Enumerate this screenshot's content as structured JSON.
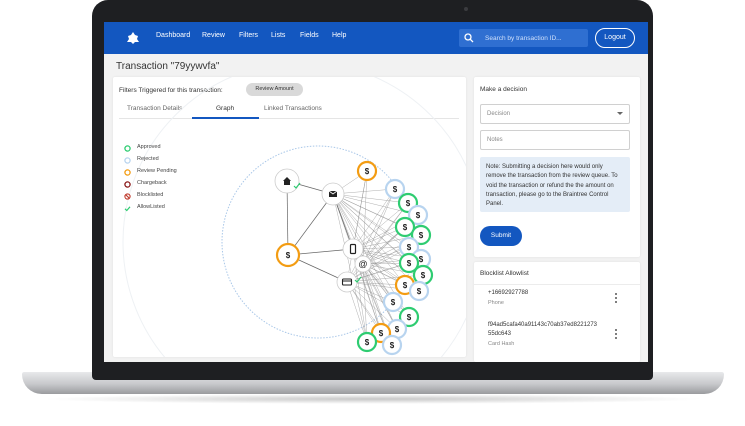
{
  "brand_color": "#1357c0",
  "nav": {
    "logo_icon": "braintree-logo-icon",
    "items": [
      {
        "label": "Dashboard"
      },
      {
        "label": "Review"
      },
      {
        "label": "Filters"
      },
      {
        "label": "Lists"
      },
      {
        "label": "Fields"
      },
      {
        "label": "Help"
      }
    ],
    "search_placeholder": "Search by transaction ID...",
    "logout_label": "Logout"
  },
  "page": {
    "title": "Transaction \"79yywvfa\""
  },
  "transaction": {
    "filters_label": "Filters Triggered for this transaction:",
    "filter_chip": "Review Amount",
    "tabs": [
      {
        "label": "Transaction Details",
        "active": false
      },
      {
        "label": "Graph",
        "active": true
      },
      {
        "label": "Linked Transactions",
        "active": false
      }
    ],
    "legend": [
      {
        "label": "Approved",
        "icon": "approved-ring-icon",
        "color": "#2ecc71"
      },
      {
        "label": "Rejected",
        "icon": "rejected-ring-icon",
        "color": "#b8d4ef"
      },
      {
        "label": "Review Pending",
        "icon": "review-pending-ring-icon",
        "color": "#f39c12"
      },
      {
        "label": "Chargeback",
        "icon": "chargeback-ring-icon",
        "color": "#8b1a1a"
      },
      {
        "label": "Blocklisted",
        "icon": "blocklisted-icon",
        "color": "#c0392b"
      },
      {
        "label": "AllowListed",
        "icon": "checkmark-icon",
        "color": "#2ecc71"
      }
    ],
    "graph": {
      "node_icons": [
        "home-icon",
        "mail-icon",
        "phone-icon",
        "at-sign-icon",
        "card-icon",
        "dollar-icon"
      ]
    }
  },
  "decision": {
    "title": "Make a decision",
    "decision_placeholder": "Decision",
    "notes_placeholder": "Notes",
    "note_text": "Note: Submitting a decision here would only remove the transaction from the review queue. To void the transaction or refund the the amount on transaction, please go to the Braintree Control Panel.",
    "submit_label": "Submit"
  },
  "blocklist": {
    "title": "Blocklist Allowlist",
    "items": [
      {
        "value": "+16692927788",
        "type": "Phone"
      },
      {
        "value_line1": "f94ad5cafa40a91143c70ab37ed8221273",
        "value_line2": "55dc643",
        "type": "Card Hash"
      }
    ]
  }
}
